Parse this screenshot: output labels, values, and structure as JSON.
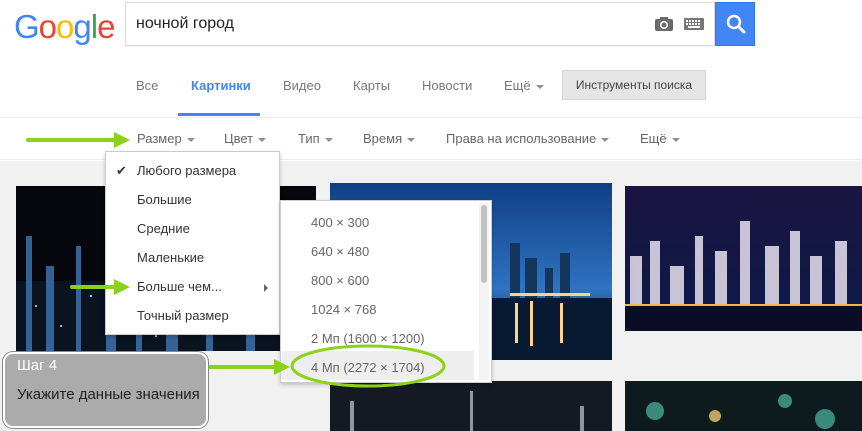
{
  "logo": {
    "letters": [
      "G",
      "o",
      "o",
      "g",
      "l",
      "e"
    ],
    "colors": [
      "#4285f4",
      "#ea4335",
      "#fbbc05",
      "#4285f4",
      "#34a853",
      "#ea4335"
    ]
  },
  "search": {
    "value": "ночной город",
    "camera_icon": "camera-icon",
    "keyboard_icon": "keyboard-icon",
    "search_icon": "magnifier-icon"
  },
  "tabs": [
    {
      "label": "Все"
    },
    {
      "label": "Картинки"
    },
    {
      "label": "Видео"
    },
    {
      "label": "Карты"
    },
    {
      "label": "Новости"
    },
    {
      "label": "Ещё"
    }
  ],
  "tools_button": "Инструменты поиска",
  "toolbar": [
    {
      "label": "Размер"
    },
    {
      "label": "Цвет"
    },
    {
      "label": "Тип"
    },
    {
      "label": "Время"
    },
    {
      "label": "Права на использование"
    },
    {
      "label": "Ещё"
    }
  ],
  "size_menu": {
    "checked_icon": "checkmark-icon",
    "items": [
      {
        "label": "Любого размера",
        "checked": true
      },
      {
        "label": "Большие"
      },
      {
        "label": "Средние"
      },
      {
        "label": "Маленькие"
      },
      {
        "label": "Больше чем...",
        "has_submenu": true
      },
      {
        "label": "Точный размер"
      }
    ]
  },
  "larger_than_menu": {
    "items": [
      {
        "label": "400 × 300"
      },
      {
        "label": "640 × 480"
      },
      {
        "label": "800 × 600"
      },
      {
        "label": "1024 × 768"
      },
      {
        "label": "2 Мп (1600 × 1200)"
      },
      {
        "label": "4 Мп (2272 × 1704)",
        "highlighted": true
      }
    ]
  },
  "step": {
    "title": "Шаг 4",
    "text": "Укажите данные значения"
  },
  "colors": {
    "accent": "#4285f4",
    "annotation_green": "#8cd11a",
    "step_box": "#ababab"
  }
}
